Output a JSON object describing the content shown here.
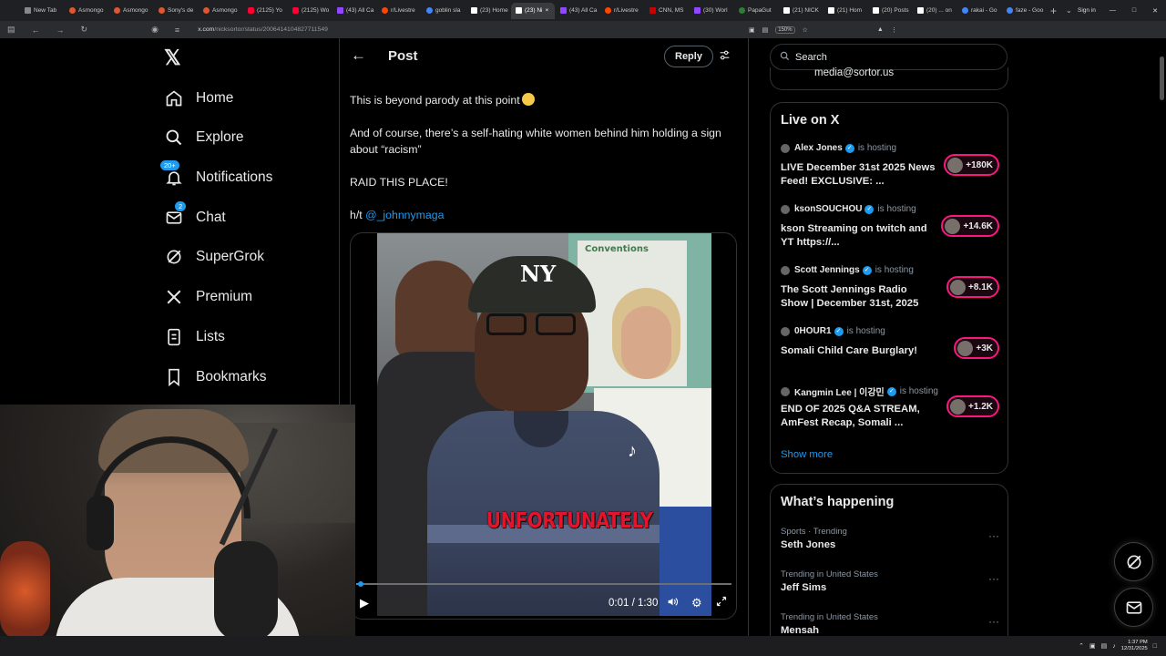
{
  "browser": {
    "tabs": [
      {
        "label": "New Tab",
        "icon": "newtab-icon",
        "kind": "news"
      },
      {
        "label": "Asmongo",
        "icon": "asmongold-icon",
        "kind": "asm"
      },
      {
        "label": "Asmongo",
        "icon": "asmongold-icon",
        "kind": "asm"
      },
      {
        "label": "Sony's de",
        "icon": "asmongold-icon",
        "kind": "asm"
      },
      {
        "label": "Asmongo",
        "icon": "asmongold-icon",
        "kind": "asm"
      },
      {
        "label": "(2125) Yo",
        "icon": "youtube-icon",
        "kind": "yt"
      },
      {
        "label": "(2125) Wo",
        "icon": "youtube-icon",
        "kind": "yt"
      },
      {
        "label": "(43) All Ca",
        "icon": "twitch-icon",
        "kind": "tw"
      },
      {
        "label": "r/Livestre",
        "icon": "reddit-icon",
        "kind": "rd"
      },
      {
        "label": "goblin sla",
        "icon": "google-icon",
        "kind": "g"
      },
      {
        "label": "(23) Home",
        "icon": "x-icon",
        "kind": "x"
      },
      {
        "label": "(23) Ni",
        "icon": "x-icon",
        "kind": "x"
      },
      {
        "label": "(43) All Ca",
        "icon": "twitch-icon",
        "kind": "tw"
      },
      {
        "label": "r/Livestre",
        "icon": "reddit-icon",
        "kind": "rd"
      },
      {
        "label": "CNN, MS",
        "icon": "cnn-icon",
        "kind": "cnn"
      },
      {
        "label": "(30) Worl",
        "icon": "twitch-icon",
        "kind": "tw"
      },
      {
        "label": "PapaGut",
        "icon": "news-icon",
        "kind": "ng"
      },
      {
        "label": "(21) NICK",
        "icon": "x-icon",
        "kind": "x"
      },
      {
        "label": "(21) Hom",
        "icon": "x-icon",
        "kind": "x"
      },
      {
        "label": "(20) Posts",
        "icon": "x-icon",
        "kind": "x"
      },
      {
        "label": "(20) ... on",
        "icon": "x-icon",
        "kind": "x"
      },
      {
        "label": "rakai - Go",
        "icon": "google-icon",
        "kind": "g"
      },
      {
        "label": "faze - Goo",
        "icon": "google-icon",
        "kind": "g"
      }
    ],
    "active_tab_index": 11,
    "sign_in": "Sign in",
    "url_host": "x.com",
    "url_path": "/nicksortor/status/2006414104827711549",
    "zoom": "150%"
  },
  "nav": {
    "items": [
      {
        "label": "Home",
        "icon": "home-icon"
      },
      {
        "label": "Explore",
        "icon": "search-icon"
      },
      {
        "label": "Notifications",
        "icon": "bell-icon",
        "badge": "20+"
      },
      {
        "label": "Chat",
        "icon": "mail-icon",
        "badge": "2"
      },
      {
        "label": "SuperGrok",
        "icon": "grok-icon"
      },
      {
        "label": "Premium",
        "icon": "x-logo-icon"
      },
      {
        "label": "Lists",
        "icon": "list-icon"
      },
      {
        "label": "Bookmarks",
        "icon": "bookmark-icon"
      }
    ]
  },
  "post": {
    "header_title": "Post",
    "reply_label": "Reply",
    "lines": [
      "This is beyond parody at this point",
      "And of course, there’s a self-hating white women behind him holding a sign about “racism”",
      "RAID THIS PLACE!"
    ],
    "ht_prefix": "h/t",
    "ht_mention": "@_johnnymaga",
    "video": {
      "caption": "UNFORTUNATELY",
      "poster_heading": "Conventions",
      "time": "0:01 / 1:30",
      "progress_fraction": 0.011
    }
  },
  "sidebar": {
    "search_placeholder": "Search",
    "top_stub_text": "media@sortor.us",
    "live": {
      "title": "Live on X",
      "items": [
        {
          "host": "Alex Jones",
          "verified": true,
          "status": "is hosting",
          "title": "LIVE December 31st 2025 News Feed! EXCLUSIVE: ...",
          "count": "+180K"
        },
        {
          "host": "ksonSOUCHOU",
          "verified": true,
          "status": "is hosting",
          "title": "kson Streaming on twitch and YT https://...",
          "count": "+14.6K"
        },
        {
          "host": "Scott Jennings",
          "verified": true,
          "status": "is hosting",
          "title": "The Scott Jennings Radio Show | December 31st, 2025",
          "count": "+8.1K"
        },
        {
          "host": "0HOUR1",
          "verified": true,
          "status": "is hosting",
          "title": "Somali Child Care Burglary!",
          "count": "+3K"
        },
        {
          "host": "Kangmin Lee | 이강민",
          "verified": true,
          "status": "is hosting",
          "title": "END OF 2025 Q&A STREAM, AmFest Recap, Somali ...",
          "count": "+1.2K"
        }
      ],
      "show_more": "Show more"
    },
    "happening": {
      "title": "What’s happening",
      "trends": [
        {
          "context": "Sports · Trending",
          "name": "Seth Jones"
        },
        {
          "context": "Trending in United States",
          "name": "Jeff Sims"
        },
        {
          "context": "Trending in United States",
          "name": "Mensah"
        }
      ]
    }
  },
  "taskbar": {
    "time": "1:37 PM",
    "date": "12/31/2025"
  },
  "colors": {
    "accent": "#1d9bf0",
    "live_pink": "#f91880",
    "background": "#000000",
    "border": "#2f3336"
  }
}
